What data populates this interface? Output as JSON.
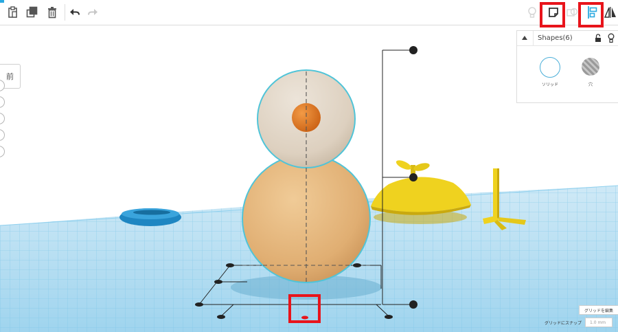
{
  "toolbar": {
    "icons": [
      "paste-icon",
      "duplicate-icon",
      "trash-icon",
      "undo-icon",
      "redo-icon",
      "lightbulb-icon",
      "note-icon",
      "align-icon",
      "mirror-icon"
    ]
  },
  "left_dock": {
    "button_label": "前"
  },
  "shapes_panel": {
    "title": "Shapes(6)",
    "solid_label": "ソリッド",
    "hole_label": "穴"
  },
  "grid": {
    "edit_button_label": "グリッドを編集",
    "snap_label": "グリッドにスナップ",
    "snap_value": "1.0 mm"
  },
  "colors": {
    "accent": "#2aa9e0",
    "highlight": "#e8141b",
    "grid_blue": "#7cc6e8",
    "snowman_body": "#e2b37a",
    "snowman_head": "#ddd2c4",
    "nose": "#e07a22",
    "hat_yellow": "#efd21f",
    "torus_blue": "#1e86c2"
  }
}
